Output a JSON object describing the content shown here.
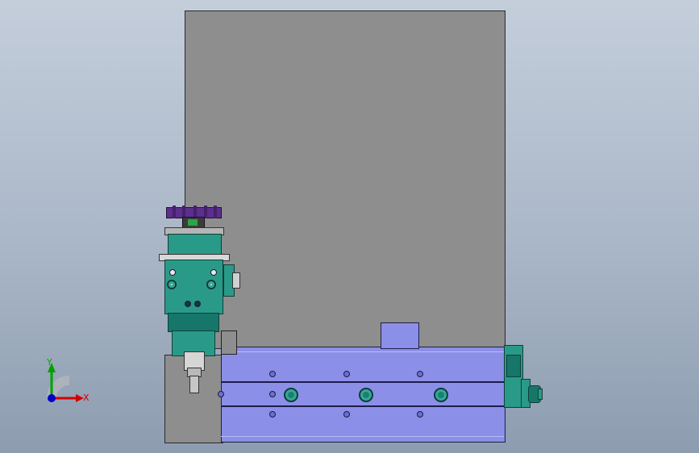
{
  "viewport": {
    "background_top": "#c4cedb",
    "background_bottom": "#8d9cb0"
  },
  "model": {
    "plate_color": "#8e8e8e",
    "rail_color": "#8b8fe8",
    "cylinder_color": "#2a9a88",
    "knob_color": "#5b2f8c"
  },
  "triad": {
    "x_label": "X",
    "y_label": "Y",
    "x_color": "#d40000",
    "y_color": "#00a000",
    "z_color": "#0000c8"
  }
}
